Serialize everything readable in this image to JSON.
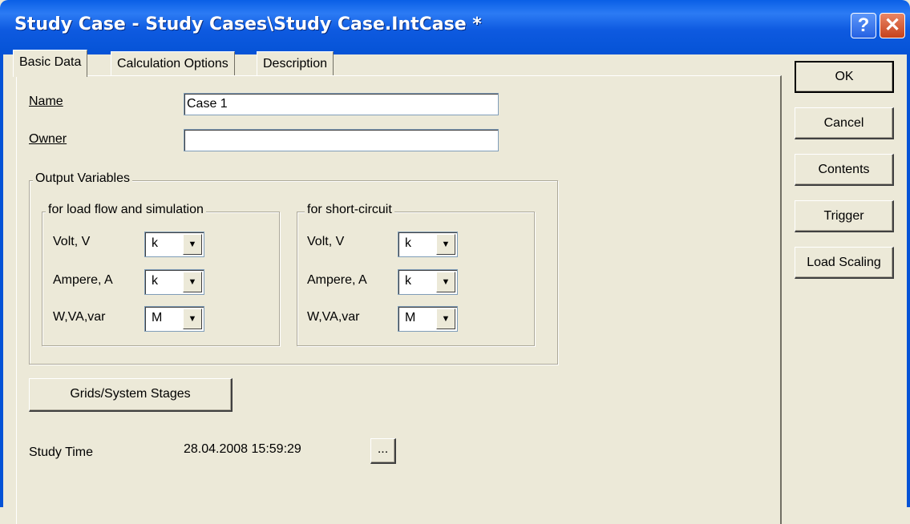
{
  "window": {
    "title": "Study Case - Study Cases\\Study Case.IntCase *",
    "help_label": "?",
    "close_label": "✕"
  },
  "tabs": [
    {
      "label": "Basic Data",
      "active": true
    },
    {
      "label": "Calculation Options",
      "active": false
    },
    {
      "label": "Description",
      "active": false
    }
  ],
  "fields": {
    "name_label": "Name",
    "name_value": "Case 1",
    "owner_label": "Owner",
    "owner_value": ""
  },
  "output_variables": {
    "title": "Output Variables",
    "load_flow": {
      "title": "for load flow and simulation",
      "rows": [
        {
          "label": "Volt, V",
          "value": "k"
        },
        {
          "label": "Ampere, A",
          "value": "k"
        },
        {
          "label": "W,VA,var",
          "value": "M"
        }
      ]
    },
    "short_circuit": {
      "title": "for short-circuit",
      "rows": [
        {
          "label": "Volt, V",
          "value": "k"
        },
        {
          "label": "Ampere, A",
          "value": "k"
        },
        {
          "label": "W,VA,var",
          "value": "M"
        }
      ]
    }
  },
  "grids_button": "Grids/System Stages",
  "study_time": {
    "label": "Study Time",
    "value": "28.04.2008 15:59:29",
    "browse_label": "..."
  },
  "side_buttons": {
    "ok": "OK",
    "cancel": "Cancel",
    "contents": "Contents",
    "trigger": "Trigger",
    "load_scaling": "Load Scaling"
  },
  "colors": {
    "title_bar": "#0553d6",
    "dialog_bg": "#ece9d8",
    "close_button": "#c6421c"
  }
}
